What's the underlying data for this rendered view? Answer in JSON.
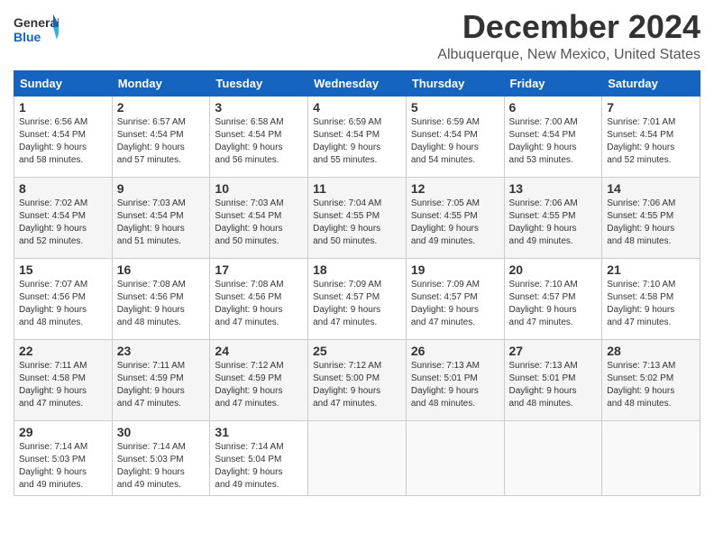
{
  "logo": {
    "line1": "General",
    "line2": "Blue"
  },
  "title": "December 2024",
  "location": "Albuquerque, New Mexico, United States",
  "weekdays": [
    "Sunday",
    "Monday",
    "Tuesday",
    "Wednesday",
    "Thursday",
    "Friday",
    "Saturday"
  ],
  "weeks": [
    [
      {
        "day": "1",
        "info": "Sunrise: 6:56 AM\nSunset: 4:54 PM\nDaylight: 9 hours\nand 58 minutes."
      },
      {
        "day": "2",
        "info": "Sunrise: 6:57 AM\nSunset: 4:54 PM\nDaylight: 9 hours\nand 57 minutes."
      },
      {
        "day": "3",
        "info": "Sunrise: 6:58 AM\nSunset: 4:54 PM\nDaylight: 9 hours\nand 56 minutes."
      },
      {
        "day": "4",
        "info": "Sunrise: 6:59 AM\nSunset: 4:54 PM\nDaylight: 9 hours\nand 55 minutes."
      },
      {
        "day": "5",
        "info": "Sunrise: 6:59 AM\nSunset: 4:54 PM\nDaylight: 9 hours\nand 54 minutes."
      },
      {
        "day": "6",
        "info": "Sunrise: 7:00 AM\nSunset: 4:54 PM\nDaylight: 9 hours\nand 53 minutes."
      },
      {
        "day": "7",
        "info": "Sunrise: 7:01 AM\nSunset: 4:54 PM\nDaylight: 9 hours\nand 52 minutes."
      }
    ],
    [
      {
        "day": "8",
        "info": "Sunrise: 7:02 AM\nSunset: 4:54 PM\nDaylight: 9 hours\nand 52 minutes."
      },
      {
        "day": "9",
        "info": "Sunrise: 7:03 AM\nSunset: 4:54 PM\nDaylight: 9 hours\nand 51 minutes."
      },
      {
        "day": "10",
        "info": "Sunrise: 7:03 AM\nSunset: 4:54 PM\nDaylight: 9 hours\nand 50 minutes."
      },
      {
        "day": "11",
        "info": "Sunrise: 7:04 AM\nSunset: 4:55 PM\nDaylight: 9 hours\nand 50 minutes."
      },
      {
        "day": "12",
        "info": "Sunrise: 7:05 AM\nSunset: 4:55 PM\nDaylight: 9 hours\nand 49 minutes."
      },
      {
        "day": "13",
        "info": "Sunrise: 7:06 AM\nSunset: 4:55 PM\nDaylight: 9 hours\nand 49 minutes."
      },
      {
        "day": "14",
        "info": "Sunrise: 7:06 AM\nSunset: 4:55 PM\nDaylight: 9 hours\nand 48 minutes."
      }
    ],
    [
      {
        "day": "15",
        "info": "Sunrise: 7:07 AM\nSunset: 4:56 PM\nDaylight: 9 hours\nand 48 minutes."
      },
      {
        "day": "16",
        "info": "Sunrise: 7:08 AM\nSunset: 4:56 PM\nDaylight: 9 hours\nand 48 minutes."
      },
      {
        "day": "17",
        "info": "Sunrise: 7:08 AM\nSunset: 4:56 PM\nDaylight: 9 hours\nand 47 minutes."
      },
      {
        "day": "18",
        "info": "Sunrise: 7:09 AM\nSunset: 4:57 PM\nDaylight: 9 hours\nand 47 minutes."
      },
      {
        "day": "19",
        "info": "Sunrise: 7:09 AM\nSunset: 4:57 PM\nDaylight: 9 hours\nand 47 minutes."
      },
      {
        "day": "20",
        "info": "Sunrise: 7:10 AM\nSunset: 4:57 PM\nDaylight: 9 hours\nand 47 minutes."
      },
      {
        "day": "21",
        "info": "Sunrise: 7:10 AM\nSunset: 4:58 PM\nDaylight: 9 hours\nand 47 minutes."
      }
    ],
    [
      {
        "day": "22",
        "info": "Sunrise: 7:11 AM\nSunset: 4:58 PM\nDaylight: 9 hours\nand 47 minutes."
      },
      {
        "day": "23",
        "info": "Sunrise: 7:11 AM\nSunset: 4:59 PM\nDaylight: 9 hours\nand 47 minutes."
      },
      {
        "day": "24",
        "info": "Sunrise: 7:12 AM\nSunset: 4:59 PM\nDaylight: 9 hours\nand 47 minutes."
      },
      {
        "day": "25",
        "info": "Sunrise: 7:12 AM\nSunset: 5:00 PM\nDaylight: 9 hours\nand 47 minutes."
      },
      {
        "day": "26",
        "info": "Sunrise: 7:13 AM\nSunset: 5:01 PM\nDaylight: 9 hours\nand 48 minutes."
      },
      {
        "day": "27",
        "info": "Sunrise: 7:13 AM\nSunset: 5:01 PM\nDaylight: 9 hours\nand 48 minutes."
      },
      {
        "day": "28",
        "info": "Sunrise: 7:13 AM\nSunset: 5:02 PM\nDaylight: 9 hours\nand 48 minutes."
      }
    ],
    [
      {
        "day": "29",
        "info": "Sunrise: 7:14 AM\nSunset: 5:03 PM\nDaylight: 9 hours\nand 49 minutes."
      },
      {
        "day": "30",
        "info": "Sunrise: 7:14 AM\nSunset: 5:03 PM\nDaylight: 9 hours\nand 49 minutes."
      },
      {
        "day": "31",
        "info": "Sunrise: 7:14 AM\nSunset: 5:04 PM\nDaylight: 9 hours\nand 49 minutes."
      },
      {
        "day": "",
        "info": ""
      },
      {
        "day": "",
        "info": ""
      },
      {
        "day": "",
        "info": ""
      },
      {
        "day": "",
        "info": ""
      }
    ]
  ]
}
